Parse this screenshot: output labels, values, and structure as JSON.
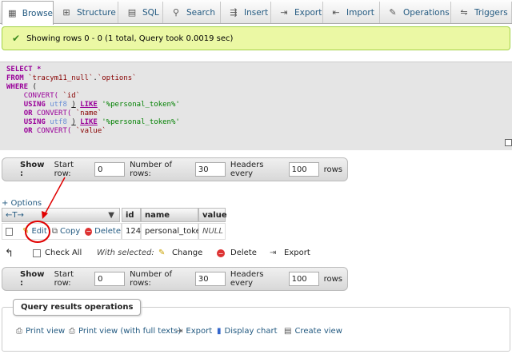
{
  "tabs": [
    {
      "label": "Browse",
      "icon": "browse-icon"
    },
    {
      "label": "Structure",
      "icon": "structure-icon"
    },
    {
      "label": "SQL",
      "icon": "sql-icon"
    },
    {
      "label": "Search",
      "icon": "search-icon"
    },
    {
      "label": "Insert",
      "icon": "insert-icon"
    },
    {
      "label": "Export",
      "icon": "export-icon"
    },
    {
      "label": "Import",
      "icon": "import-icon"
    },
    {
      "label": "Operations",
      "icon": "wrench-icon"
    },
    {
      "label": "Triggers",
      "icon": "triggers-icon"
    }
  ],
  "success": {
    "text": "Showing rows 0 - 0 (1 total, Query took 0.0019 sec)"
  },
  "sql": {
    "select": "SELECT",
    "star": "*",
    "from": "FROM",
    "db": "`tracym11_null`",
    "dot": ".",
    "table": "`options`",
    "where": "WHERE",
    "open": "(",
    "convert": "CONVERT(",
    "col_id": "`id`",
    "col_name": "`name`",
    "col_value": "`value`",
    "using": "USING",
    "charset": "utf8",
    "close": ")",
    "like": "LIKE",
    "pattern": "'%personal_token%'",
    "or": "OR"
  },
  "navbar": {
    "show": "Show :",
    "start_row_label": "Start row:",
    "start_row": "0",
    "num_rows_label": "Number of rows:",
    "num_rows": "30",
    "headers_label": "Headers every",
    "headers_every": "100",
    "rows_label": "rows"
  },
  "options_link": "+ Options",
  "table": {
    "sort_arrows": "←T→",
    "sort_indicator": "▼",
    "columns": [
      "id",
      "name",
      "value"
    ],
    "row": {
      "edit": "Edit",
      "copy": "Copy",
      "delete": "Delete",
      "id": "124",
      "name": "personal_token",
      "value": "NULL"
    }
  },
  "bulk": {
    "check_all": "Check All",
    "with_selected": "With selected:",
    "change": "Change",
    "delete": "Delete",
    "export": "Export"
  },
  "qro": {
    "title": "Query results operations",
    "items": [
      "Print view",
      "Print view (with full texts)",
      "Export",
      "Display chart",
      "Create view"
    ]
  },
  "colors": {
    "accent": "#235a81",
    "success_bg": "#ebf8a4",
    "annotation": "#e00000"
  }
}
